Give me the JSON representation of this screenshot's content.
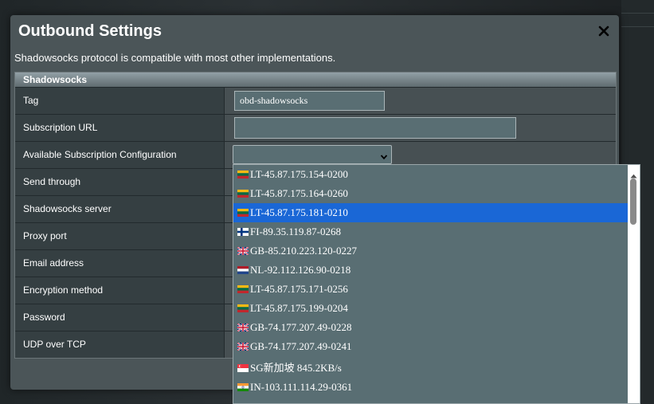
{
  "modal": {
    "title": "Outbound Settings",
    "description": "Shadowsocks protocol is compatible with most other implementations."
  },
  "table": {
    "header": "Shadowsocks",
    "rows": [
      {
        "label": "Tag",
        "value": "obd-shadowsocks"
      },
      {
        "label": "Subscription URL",
        "value": ""
      },
      {
        "label": "Available Subscription Configuration",
        "value": ""
      },
      {
        "label": "Send through"
      },
      {
        "label": "Shadowsocks server"
      },
      {
        "label": "Proxy port"
      },
      {
        "label": "Email address"
      },
      {
        "label": "Encryption method"
      },
      {
        "label": "Password"
      },
      {
        "label": "UDP over TCP"
      }
    ]
  },
  "dropdown": {
    "selected_index": 2,
    "options": [
      {
        "country": "LT",
        "label": "LT-45.87.175.154-0200"
      },
      {
        "country": "LT",
        "label": "LT-45.87.175.164-0260"
      },
      {
        "country": "LT",
        "label": "LT-45.87.175.181-0210"
      },
      {
        "country": "FI",
        "label": "FI-89.35.119.87-0268"
      },
      {
        "country": "GB",
        "label": "GB-85.210.223.120-0227"
      },
      {
        "country": "NL",
        "label": "NL-92.112.126.90-0218"
      },
      {
        "country": "LT",
        "label": "LT-45.87.175.171-0256"
      },
      {
        "country": "LT",
        "label": "LT-45.87.175.199-0204"
      },
      {
        "country": "GB",
        "label": "GB-74.177.207.49-0228"
      },
      {
        "country": "GB",
        "label": "GB-74.177.207.49-0241"
      },
      {
        "country": "SG",
        "label": "SG新加坡 845.2KB/s"
      },
      {
        "country": "IN",
        "label": "IN-103.111.114.29-0361"
      }
    ]
  },
  "icons": {
    "close": "close-icon",
    "select_arrow": "chevron-down-icon",
    "scroll_up": "scroll-up-arrow-icon"
  },
  "colors": {
    "modal_bg": "#4b5558",
    "selected_option": "#1a67d6",
    "input_bg": "#596e73"
  }
}
